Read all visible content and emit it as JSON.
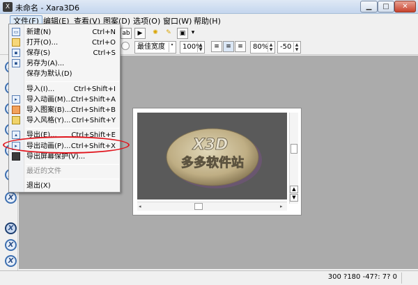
{
  "window": {
    "title": "未命名 - Xara3D6"
  },
  "menubar": [
    {
      "label": "文件(F)"
    },
    {
      "label": "编辑(E)"
    },
    {
      "label": "查看(V)"
    },
    {
      "label": "图案(D)"
    },
    {
      "label": "选项(O)"
    },
    {
      "label": "窗口(W)"
    },
    {
      "label": "帮助(H)"
    }
  ],
  "toolbar2": {
    "width_mode": "最佳宽度",
    "zoom": "100%",
    "scale": "80%",
    "value": "-50"
  },
  "file_menu": {
    "items": [
      {
        "label": "新建(N)",
        "shortcut": "Ctrl+N",
        "icon": "new-file-icon"
      },
      {
        "label": "打开(O)...",
        "shortcut": "Ctrl+O",
        "icon": "open-folder-icon"
      },
      {
        "label": "保存(S)",
        "shortcut": "Ctrl+S",
        "icon": "save-icon"
      },
      {
        "label": "另存为(A)...",
        "shortcut": "",
        "icon": "save-as-icon"
      },
      {
        "label": "保存为默认(D)",
        "shortcut": "",
        "icon": ""
      },
      {
        "label": "导入(I)...",
        "shortcut": "Ctrl+Shift+I",
        "icon": ""
      },
      {
        "label": "导入动画(M)...",
        "shortcut": "Ctrl+Shift+A",
        "icon": "import-animation-icon"
      },
      {
        "label": "导入图案(B)...",
        "shortcut": "Ctrl+Shift+B",
        "icon": "import-pattern-icon"
      },
      {
        "label": "导入风格(Y)...",
        "shortcut": "Ctrl+Shift+Y",
        "icon": "import-style-icon"
      },
      {
        "label": "导出(E)...",
        "shortcut": "Ctrl+Shift+E",
        "icon": "export-icon"
      },
      {
        "label": "导出动画(P)...",
        "shortcut": "Ctrl+Shift+X",
        "icon": "export-animation-icon"
      },
      {
        "label": "导出屏幕保护(V)...",
        "shortcut": "",
        "icon": "export-screensaver-icon"
      },
      {
        "label": "最近的文件",
        "shortcut": "",
        "icon": ""
      },
      {
        "label": "退出(X)",
        "shortcut": "",
        "icon": ""
      }
    ]
  },
  "canvas": {
    "logo_line1": "X3D",
    "logo_line2": "多多软件站"
  },
  "statusbar": {
    "text": "300 ?180  -47?: 7? 0"
  },
  "colors": {
    "highlight": "#e0141c",
    "workspace": "#abababab",
    "canvas": "#5a5a5a"
  }
}
